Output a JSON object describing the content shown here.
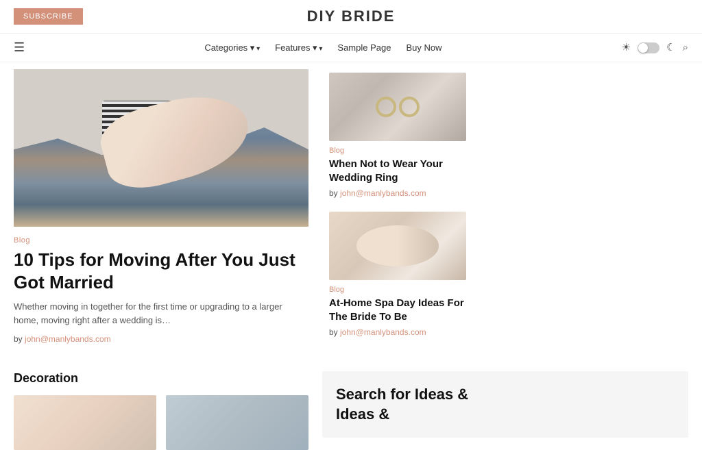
{
  "header": {
    "subscribe_label": "SUBSCRIBE",
    "site_title": "DIY BRIDE"
  },
  "nav": {
    "hamburger": "☰",
    "items": [
      {
        "label": "Categories",
        "has_arrow": true
      },
      {
        "label": "Features",
        "has_arrow": true
      },
      {
        "label": "Sample Page",
        "has_arrow": false
      },
      {
        "label": "Buy Now",
        "has_arrow": false
      }
    ],
    "sun_icon": "☀",
    "moon_icon": "☾",
    "search_icon": "🔍"
  },
  "featured": {
    "category": "Blog",
    "title": "10 Tips for Moving After You Just Got Married",
    "excerpt": "Whether moving in together for the first time or upgrading to a larger home, moving right after a wedding is…",
    "author_prefix": "by",
    "author": "john@manlybands.com"
  },
  "sidebar": {
    "card1": {
      "category": "Blog",
      "title": "When Not to Wear Your Wedding Ring",
      "author_prefix": "by",
      "author": "john@manlybands.com"
    },
    "card2": {
      "category": "Blog",
      "title": "At-Home Spa Day Ideas For The Bride To Be",
      "author_prefix": "by",
      "author": "john@manlybands.com"
    }
  },
  "lower": {
    "section_heading": "Decoration",
    "search_heading": "Search for Ideas &"
  }
}
